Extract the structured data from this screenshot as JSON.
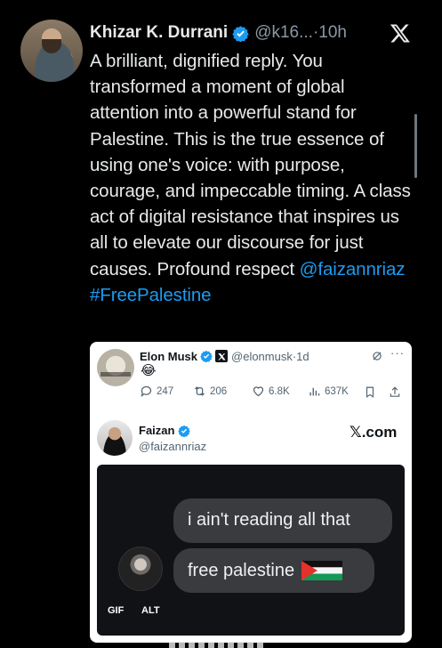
{
  "post": {
    "author": {
      "display_name": "Khizar K. Durrani",
      "handle_time": "@k16...·10h"
    },
    "text_main": "A brilliant, dignified reply. You transformed a moment of global attention into a powerful stand for Palestine. This is the true essence of using one's voice: with purpose, courage, and impeccable timing. A class act of digital resistance that inspires us all to elevate our discourse for just causes. Profound respect ",
    "mention": "@faizannriaz",
    "hashtag": "#FreePalestine"
  },
  "quote": {
    "author_name": "Elon Musk",
    "handle_time": "@elonmusk·1d",
    "emoji": "😂",
    "more": "···",
    "actions": {
      "replies": "247",
      "reposts": "206",
      "likes": "6.8K",
      "views": "637K"
    },
    "inner": {
      "name": "Faizan",
      "handle": "@faizannriaz",
      "brand": "𝕏.com",
      "bubble1": "i ain't reading all that",
      "bubble2": "free palestine",
      "gif_badge": "GIF",
      "alt_badge": "ALT"
    }
  },
  "colors": {
    "background": "#000000",
    "text": "#e7e9ea",
    "link": "#1d9bf0",
    "verified": "#1d9bf0",
    "secondary": "#8b98a5"
  }
}
